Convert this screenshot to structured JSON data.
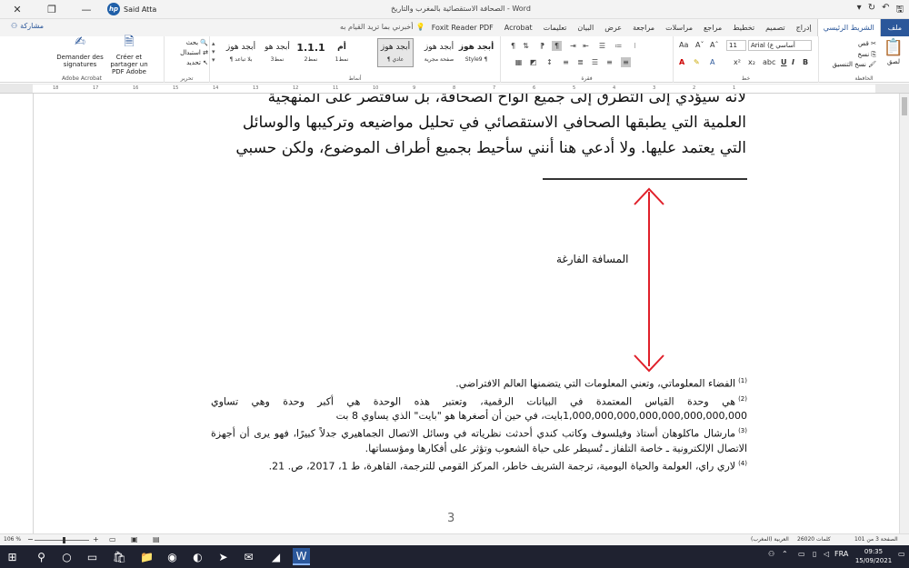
{
  "titlebar": {
    "user_name": "Said Atta",
    "hp_logo": "hp",
    "doc_title": "الصحافة الاستقصائية بالمغرب والتاريخ  -  Word",
    "close_glyph": "✕",
    "restore_glyph": "❐",
    "minimize_glyph": "—",
    "ribbon_display_glyph": "▣",
    "qat_icons": [
      "▾",
      "↻",
      "↶",
      "🖫"
    ]
  },
  "tabs": {
    "share_label": "مشاركة",
    "tell_me": "أخبرني بما تريد القيام به",
    "items": [
      "ملف",
      "الشريط الرئيسي",
      "إدراج",
      "تصميم",
      "تخطيط",
      "مراجع",
      "مراسلات",
      "مراجعة",
      "عرض",
      "البيان",
      "تعليمات",
      "Acrobat",
      "Foxit Reader PDF"
    ],
    "file_index": 0,
    "active_index": 1
  },
  "ribbon": {
    "acrobat": {
      "btn1": "Demander des signatures",
      "btn2": "Créer et partager un PDF Adobe",
      "group": "Adobe Acrobat"
    },
    "editing": {
      "find": "بحث",
      "replace": "استبدال",
      "select": "تحديد",
      "group": "تحرير"
    },
    "styles": {
      "items": [
        {
          "preview": "أبجد هوز",
          "name": "¶ بلا تباعد"
        },
        {
          "preview": "أبجد هو",
          "name": "نمط3"
        },
        {
          "preview": "1.1.1",
          "name": "نمط2"
        },
        {
          "preview": "أم",
          "name": "نمط1"
        },
        {
          "preview": "أبجد هوز",
          "name": "¶ عادي"
        },
        {
          "preview": "أبجد هوز",
          "name": "صفحة مجرية"
        },
        {
          "preview": "أبجد هوز",
          "name": "Style9 ¶"
        }
      ],
      "selected_index": 4,
      "group": "أنماط"
    },
    "paragraph_group": "فقرة",
    "font": {
      "name": "Arial (أساسي ع",
      "size": "11",
      "group": "خط"
    },
    "clipboard": {
      "paste": "لصق",
      "cut": "قص",
      "copy": "نسخ",
      "format_painter": "نسخ التنسيق",
      "group": "الحافظة"
    }
  },
  "ruler": {
    "numbers": [
      "18",
      "17",
      "16",
      "15",
      "14",
      "13",
      "12",
      "11",
      "10",
      "9",
      "8",
      "7",
      "6",
      "5",
      "4",
      "3",
      "2",
      "1"
    ]
  },
  "document": {
    "body_lines": [
      "لأنه سيؤدي إلى التطرق إلى جميع ألواح الصحافة، بل سأقتصر على المنهجية",
      "العلمية التي يطبقها الصحافي الاستقصائي في تحليل مواضيعه وتركيبها والوسائل",
      "التي يعتمد عليها. ولا أدعي هنا أنني سأحيط بجميع أطراف الموضوع، ولكن حسبي"
    ],
    "arrow_label": "المسافة الفارغة",
    "footnotes": [
      {
        "num": "(1)",
        "text": "الفضاء المعلوماتي، وتعني المعلومات التي يتضمنها العالم الافتراضي."
      },
      {
        "num": "(2)",
        "text": "هي وحدة القياس المعتمدة في البيانات الرقمية، وتعتبر هذه الوحدة هي أكبر وحدة وهي تساوي 1,000,000,000,000,000,000,000,000بايت، في حين أن أصغرها هو \"بايت\" الذي يساوي 8 بت"
      },
      {
        "num": "(3)",
        "text": "مارشال ماكلوهان أستاذ وفيلسوف وكاتب كندي أحدثت نظرياته في وسائل الاتصال الجماهيري جدلاً كبيرًا، فهو يرى أن أجهزة الاتصال الإلكترونية ـ خاصة التلفاز ـ تُسيطر على حياة الشعوب وتؤثر على أفكارها ومؤسساتها."
      },
      {
        "num": "(4)",
        "text": "لاري راي، العولمة والحياة اليومية، ترجمة الشريف خاطر، المركز القومي للترجمة، القاهرة، ط 1، 2017، ص. 21."
      }
    ],
    "page_number": "3"
  },
  "statusbar": {
    "page": "الصفحة 3 من 101",
    "words": "26020 كلمات",
    "language": "العربية (المغرب)",
    "zoom": "106 %",
    "zoom_level_fraction": 0.53
  },
  "taskbar": {
    "time": "09:35",
    "date": "15/09/2021",
    "lang": "FRA"
  },
  "colors": {
    "word_blue": "#2b579a",
    "taskbar": "#1f2230",
    "arrow_red": "#e0202a"
  }
}
